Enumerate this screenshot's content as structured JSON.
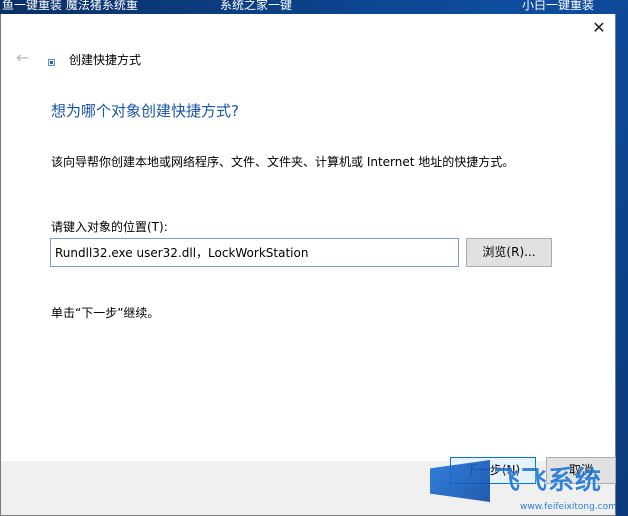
{
  "desktop": {
    "items": [
      "鱼一键重装 魔法猪系统重",
      "系统之家一键",
      "小白一键重装"
    ]
  },
  "dialog": {
    "close_glyph": "✕",
    "back_glyph": "←",
    "title": "创建快捷方式",
    "heading": "想为哪个对象创建快捷方式?",
    "description": "该向导帮你创建本地或网络程序、文件、文件夹、计算机或 Internet 地址的快捷方式。",
    "location_label": "请键入对象的位置(T):",
    "location_value": "Rundll32.exe user32.dll，LockWorkStation",
    "browse_label": "浏览(R)...",
    "hint": "单击“下一步”继续。",
    "next_label": "下一步(N)",
    "cancel_label": "取消"
  },
  "watermark": {
    "text": "飞飞系统",
    "url": "www.feifeixitong.com"
  },
  "colors": {
    "heading": "#1a53a8",
    "accent_border": "#0078d7",
    "desktop_bg": "#0b3a7a"
  }
}
